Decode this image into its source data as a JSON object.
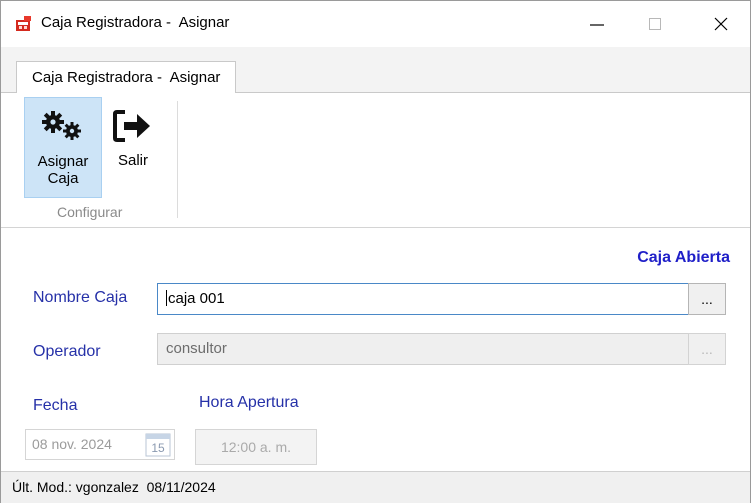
{
  "window": {
    "title": "Caja Registradora -  Asignar"
  },
  "tabs": [
    {
      "label": "Caja Registradora -  Asignar"
    }
  ],
  "ribbon": {
    "assign_label_line1": "Asignar",
    "assign_label_line2": "Caja",
    "exit_label": "Salir",
    "group_label": "Configurar"
  },
  "form": {
    "status": "Caja Abierta",
    "nombre_caja_label": "Nombre Caja",
    "nombre_caja_value": "caja 001",
    "operador_label": "Operador",
    "operador_value": "consultor",
    "fecha_label": "Fecha",
    "hora_label": "Hora Apertura",
    "fecha_value": "08 nov. 2024",
    "calendar_day": "15",
    "hora_value": "12:00 a. m.",
    "ellipsis": "..."
  },
  "statusbar": {
    "text": "Últ. Mod.: vgonzalez  08/11/2024"
  },
  "colors": {
    "label_blue": "#2631a8",
    "status_blue": "#1f1fc8",
    "ribbon_selected": "#cde4f7"
  },
  "icons": [
    "app-icon",
    "minimize-icon",
    "maximize-icon",
    "close-icon",
    "gears-icon",
    "exit-icon",
    "calendar-icon"
  ]
}
